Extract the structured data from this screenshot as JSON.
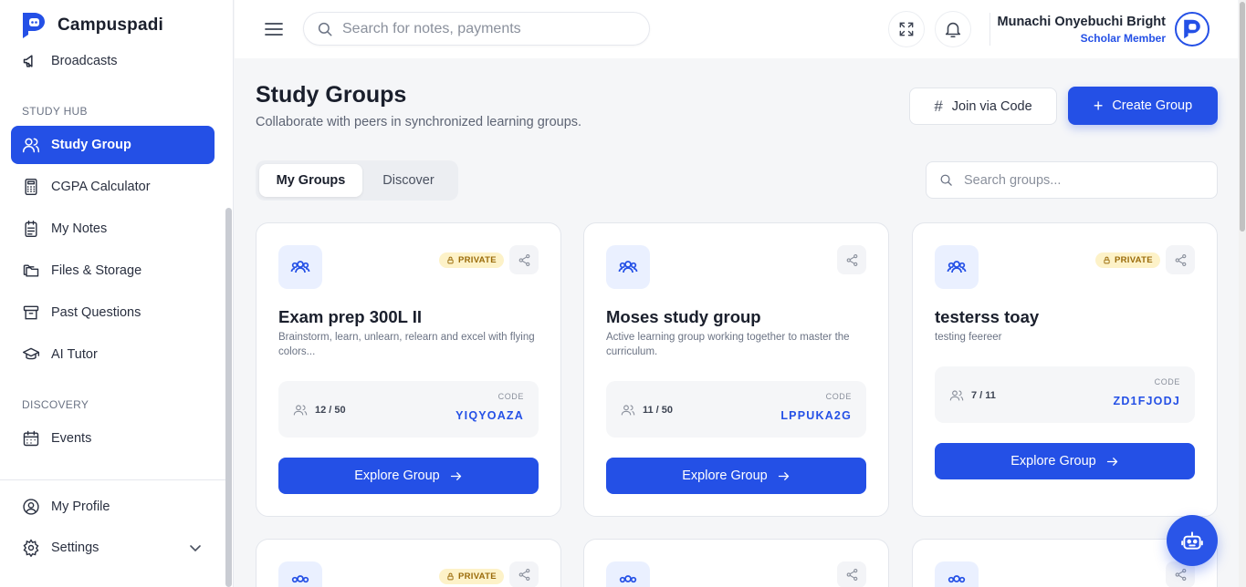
{
  "app": {
    "name": "Campuspadi",
    "brand_color": "#2450e6"
  },
  "sidebar": {
    "top_item": {
      "label": "Broadcasts",
      "icon": "megaphone-icon"
    },
    "sections": [
      {
        "label": "STUDY HUB"
      },
      {
        "label": "DISCOVERY"
      }
    ],
    "items": [
      {
        "label": "Study Group",
        "icon": "users-icon",
        "active": true
      },
      {
        "label": "CGPA Calculator",
        "icon": "calculator-icon"
      },
      {
        "label": "My Notes",
        "icon": "notes-icon"
      },
      {
        "label": "Files & Storage",
        "icon": "folder-icon"
      },
      {
        "label": "Past Questions",
        "icon": "archive-icon"
      },
      {
        "label": "AI Tutor",
        "icon": "graduation-cap-icon"
      },
      {
        "label": "Events",
        "icon": "calendar-icon"
      }
    ],
    "bottom_items": [
      {
        "label": "My Profile",
        "icon": "user-circle-icon"
      },
      {
        "label": "Settings",
        "icon": "gear-icon"
      }
    ]
  },
  "header": {
    "search_placeholder": "Search for notes, payments",
    "user_name": "Munachi Onyebuchi Bright",
    "user_role": "Scholar Member"
  },
  "main": {
    "title": "Study Groups",
    "subtitle": "Collaborate with peers in synchronized learning groups.",
    "join_label": "Join via Code",
    "create_label": "Create Group",
    "tabs": [
      {
        "label": "My Groups",
        "active": true
      },
      {
        "label": "Discover"
      }
    ],
    "group_search_placeholder": "Search groups...",
    "code_label": "CODE",
    "explore_label": "Explore Group",
    "groups": [
      {
        "title": "Exam prep 300L II",
        "description": "Brainstorm, learn, unlearn, relearn and excel with flying colors...",
        "private": true,
        "badge": "PRIVATE",
        "members": "12 / 50",
        "code": "YIQYOAZA"
      },
      {
        "title": "Moses study group",
        "description": "Active learning group working together to master the curriculum.",
        "private": false,
        "members": "11 / 50",
        "code": "LPPUKA2G"
      },
      {
        "title": "testerss toay",
        "description": "testing feereer",
        "private": true,
        "badge": "PRIVATE",
        "members": "7 / 11",
        "code": "ZD1FJODJ"
      }
    ],
    "second_row_badge": "PRIVATE"
  }
}
